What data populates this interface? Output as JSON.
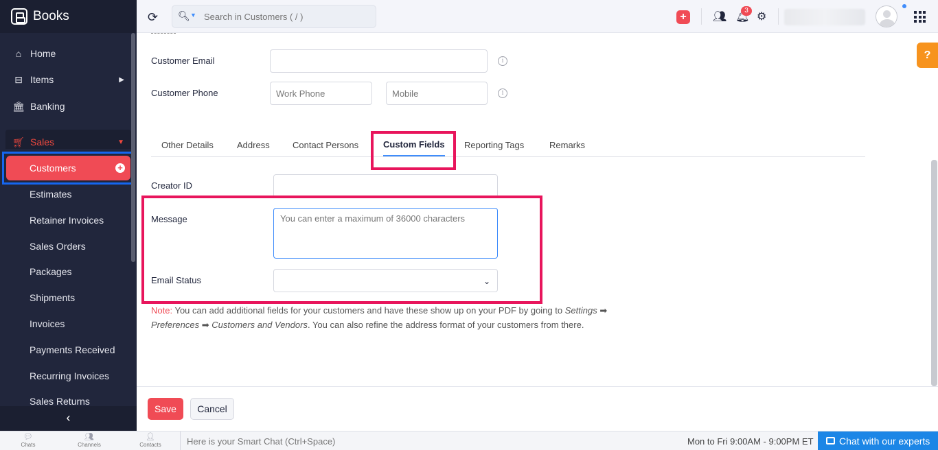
{
  "app": {
    "name": "Books"
  },
  "sidebar": {
    "items": [
      {
        "label": "Home",
        "icon": "home-icon"
      },
      {
        "label": "Items",
        "icon": "bag-icon"
      },
      {
        "label": "Banking",
        "icon": "bank-icon"
      },
      {
        "label": "Sales",
        "icon": "cart-icon"
      }
    ],
    "sales_items": [
      "Customers",
      "Estimates",
      "Retainer Invoices",
      "Sales Orders",
      "Packages",
      "Shipments",
      "Invoices",
      "Payments Received",
      "Recurring Invoices",
      "Sales Returns"
    ],
    "colors": {
      "bg": "#21263c",
      "accent": "#f04b55",
      "highlight_border": "#1666f0"
    }
  },
  "topbar": {
    "search_placeholder": "Search in Customers ( / )",
    "notification_count": "3"
  },
  "form": {
    "customer_email_label": "Customer Email",
    "customer_phone_label": "Customer Phone",
    "work_phone_placeholder": "Work Phone",
    "mobile_placeholder": "Mobile",
    "tabs": [
      "Other Details",
      "Address",
      "Contact Persons",
      "Custom Fields",
      "Reporting Tags",
      "Remarks"
    ],
    "active_tab": "Custom Fields",
    "creator_id_label": "Creator ID",
    "message_label": "Message",
    "message_placeholder": "You can enter a maximum of 36000 characters",
    "email_status_label": "Email Status",
    "note_prefix": "Note:",
    "note_text": "You can add additional fields for your customers and have these show up on your PDF by going to",
    "note_settings": "Settings",
    "note_preferences": "Preferences",
    "note_customers_vendors": "Customers and Vendors",
    "note_suffix": ". You can also refine the address format of your customers from there.",
    "highlight_color": "#e8155c"
  },
  "footer": {
    "save_label": "Save",
    "cancel_label": "Cancel"
  },
  "bottombar": {
    "items": [
      "Chats",
      "Channels",
      "Contacts"
    ],
    "smart_chat_placeholder": "Here is your Smart Chat (Ctrl+Space)",
    "hours": "Mon to Fri 9:00AM - 9:00PM ET",
    "chat_button": "Chat with our experts"
  },
  "help": {
    "label": "?"
  }
}
